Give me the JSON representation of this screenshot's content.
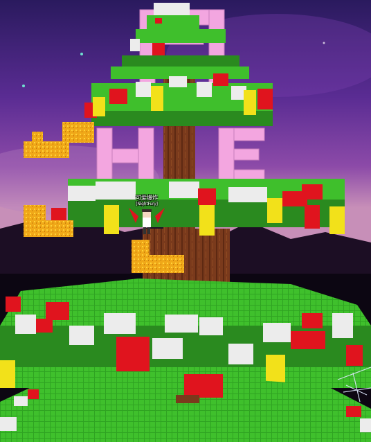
{
  "player": {
    "name": "可爱爆炸",
    "guild_tag": "[NightFury]"
  },
  "colors": {
    "sky_top": "#3b1f6e",
    "sky_mid": "#6a2fa3",
    "sky_low": "#c98bb8",
    "leaf_green": "#3fbf2c",
    "dark_green": "#2a8a1f",
    "trunk": "#7a3a1c",
    "red_block": "#e0141e",
    "yellow_block": "#f2e11a",
    "white_block": "#ececec",
    "gold_block": "#f5b21a",
    "pink_letter": "#f3a6e0"
  }
}
